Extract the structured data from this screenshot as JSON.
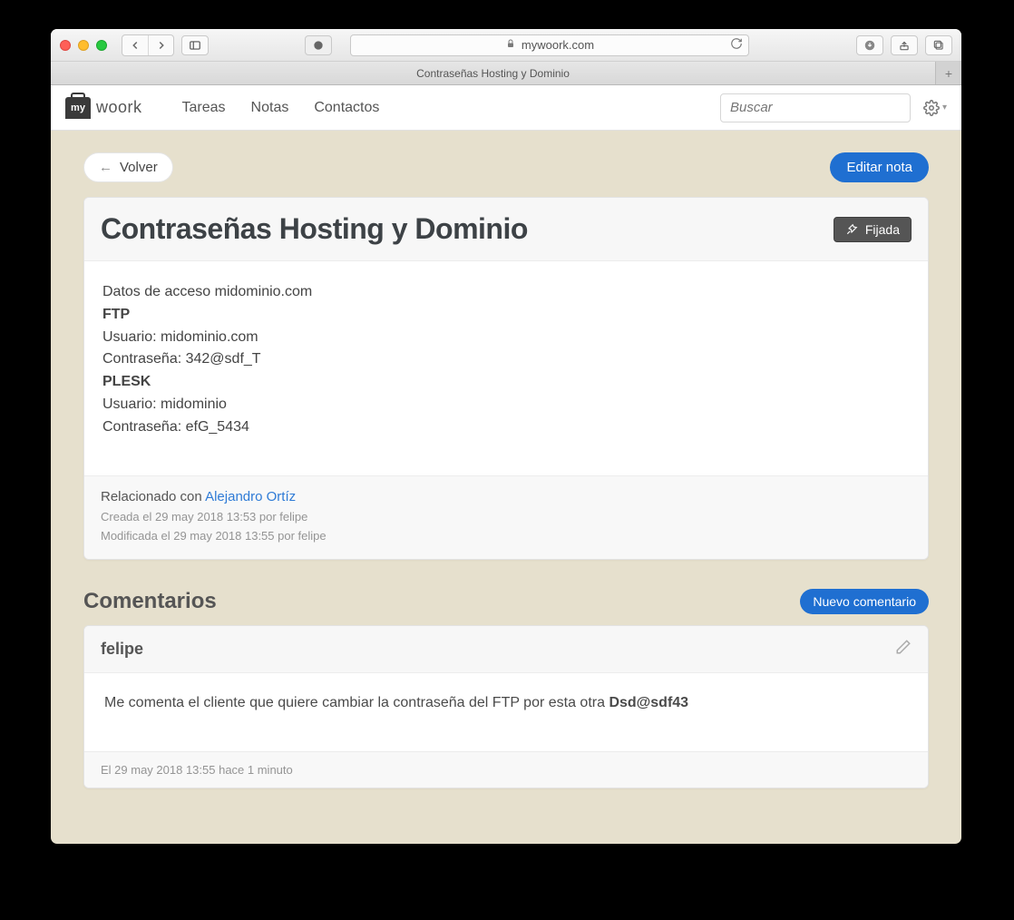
{
  "browser": {
    "url": "mywoork.com",
    "tab_title": "Contraseñas Hosting y Dominio"
  },
  "app": {
    "logo_badge": "my",
    "logo_text": "woork",
    "nav": {
      "tareas": "Tareas",
      "notas": "Notas",
      "contactos": "Contactos"
    },
    "search_placeholder": "Buscar"
  },
  "actions": {
    "back": "Volver",
    "edit_note": "Editar nota",
    "pinned": "Fijada",
    "new_comment": "Nuevo comentario"
  },
  "note": {
    "title": "Contraseñas Hosting y Dominio",
    "lines": {
      "intro": "Datos de acceso midominio.com",
      "ftp_label": "FTP",
      "ftp_user": "Usuario: midominio.com",
      "ftp_pass": "Contraseña: 342@sdf_T",
      "plesk_label": "PLESK",
      "plesk_user": "Usuario: midominio",
      "plesk_pass": "Contraseña: efG_5434"
    },
    "related_prefix": "Relacionado con ",
    "related_name": "Alejandro Ortíz",
    "created": "Creada el 29 may 2018 13:53 por felipe",
    "modified": "Modificada el 29 may 2018 13:55 por felipe"
  },
  "comments": {
    "section_title": "Comentarios",
    "items": [
      {
        "author": "felipe",
        "body_prefix": "Me comenta el cliente que quiere cambiar la contraseña del FTP por esta otra ",
        "body_strong": "Dsd@sdf43",
        "timestamp": "El 29 may 2018 13:55 hace 1 minuto"
      }
    ]
  }
}
